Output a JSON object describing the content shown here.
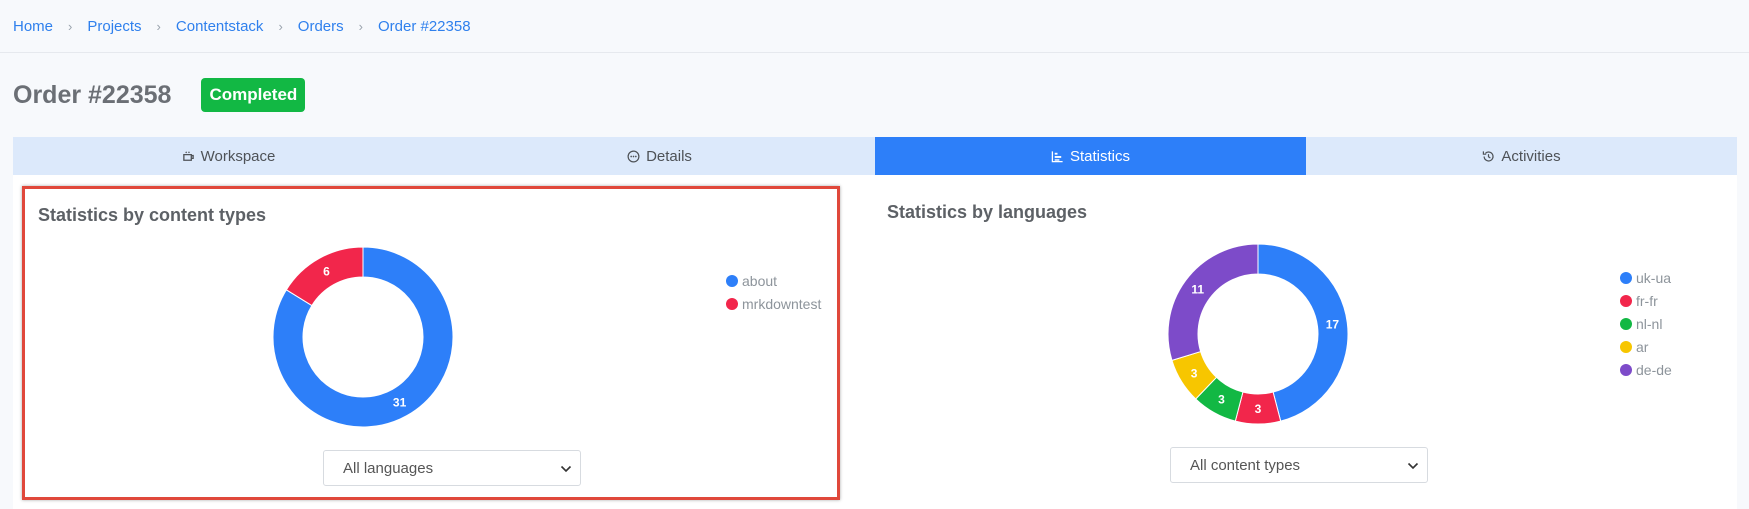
{
  "breadcrumb": [
    "Home",
    "Projects",
    "Contentstack",
    "Orders",
    "Order #22358"
  ],
  "page": {
    "title": "Order #22358",
    "status": "Completed",
    "status_color": "#12b844"
  },
  "tabs": [
    {
      "label": "Workspace",
      "icon": "workspace-icon",
      "active": false
    },
    {
      "label": "Details",
      "icon": "details-icon",
      "active": false
    },
    {
      "label": "Statistics",
      "icon": "statistics-icon",
      "active": true
    },
    {
      "label": "Activities",
      "icon": "history-icon",
      "active": false
    }
  ],
  "content_types": {
    "title": "Statistics by content types",
    "filter": "All languages",
    "legend": [
      {
        "label": "about",
        "color": "#2d7ff9",
        "value": 31
      },
      {
        "label": "mrkdowntest",
        "color": "#f2264b",
        "value": 6
      }
    ]
  },
  "languages": {
    "title": "Statistics by languages",
    "filter": "All content types",
    "legend": [
      {
        "label": "uk-ua",
        "color": "#2d7ff9",
        "value": 17
      },
      {
        "label": "fr-fr",
        "color": "#f2264b",
        "value": 3
      },
      {
        "label": "nl-nl",
        "color": "#12b844",
        "value": 3
      },
      {
        "label": "ar",
        "color": "#f7c600",
        "value": 3
      },
      {
        "label": "de-de",
        "color": "#7d4bc9",
        "value": 11
      }
    ]
  },
  "chart_data": [
    {
      "type": "pie",
      "title": "Statistics by content types",
      "categories": [
        "about",
        "mrkdowntest"
      ],
      "values": [
        31,
        6
      ]
    },
    {
      "type": "pie",
      "title": "Statistics by languages",
      "categories": [
        "uk-ua",
        "fr-fr",
        "nl-nl",
        "ar",
        "de-de"
      ],
      "values": [
        17,
        3,
        3,
        3,
        11
      ]
    }
  ]
}
